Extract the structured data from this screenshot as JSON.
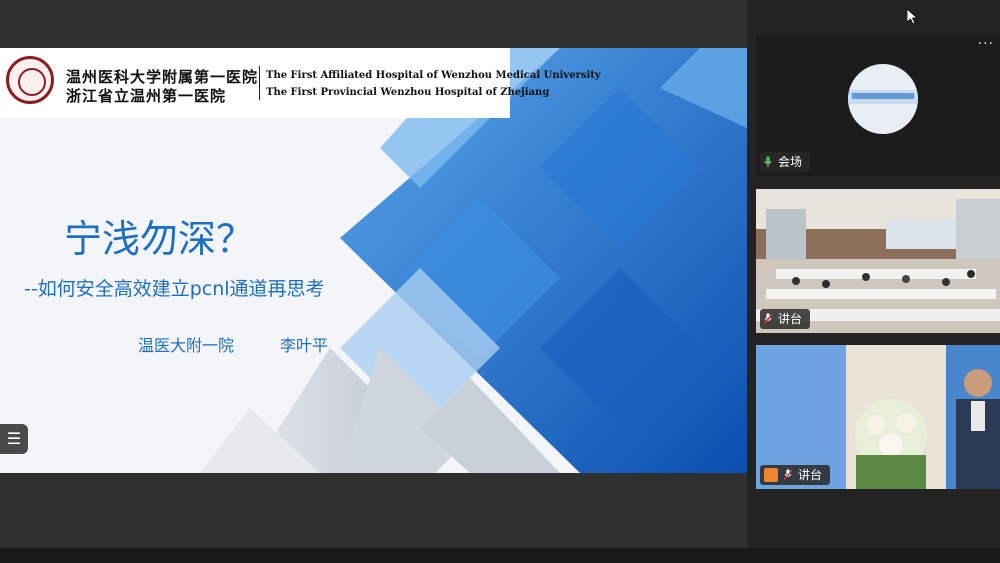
{
  "slide": {
    "hospital_cn_1": "温州医科大学附属第一医院",
    "hospital_cn_2": "浙江省立温州第一医院",
    "hospital_en_1": "The First Affiliated Hospital of Wenzhou Medical University",
    "hospital_en_2": "The First Provincial Wenzhou Hospital of Zhejiang",
    "title": "宁浅勿深？",
    "subtitle": "--如何安全高效建立pcnl通道再思考",
    "affiliation": "温医大附一院",
    "speaker": "李叶平",
    "menu_icon": "list-menu-icon",
    "accent_color": "#1f6fc0"
  },
  "participants": [
    {
      "label": "会场",
      "mic_state": "on",
      "more": "···"
    },
    {
      "label": "讲台",
      "mic_state": "muted"
    },
    {
      "label": "讲台",
      "mic_state": "muted",
      "avatar": "user-avatar-icon"
    }
  ]
}
